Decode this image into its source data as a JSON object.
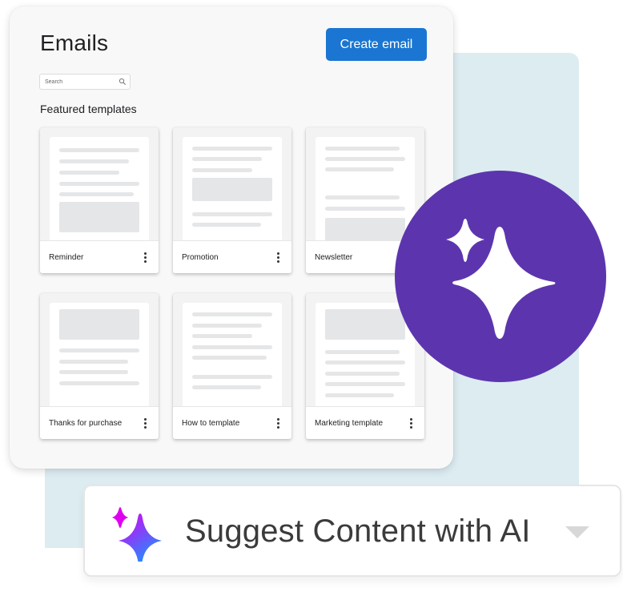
{
  "header": {
    "title": "Emails",
    "create_button": "Create email"
  },
  "search": {
    "placeholder": "Search",
    "value": "",
    "icon": "search-icon"
  },
  "featured": {
    "title": "Featured templates",
    "templates": [
      {
        "name": "Reminder",
        "menu_icon": "more-vert-icon"
      },
      {
        "name": "Promotion",
        "menu_icon": "more-vert-icon"
      },
      {
        "name": "Newsletter",
        "menu_icon": "more-vert-icon"
      },
      {
        "name": "Thanks for purchase",
        "menu_icon": "more-vert-icon"
      },
      {
        "name": "How to template",
        "menu_icon": "more-vert-icon"
      },
      {
        "name": "Marketing template",
        "menu_icon": "more-vert-icon"
      }
    ]
  },
  "ai_badge": {
    "icon": "sparkle-icon"
  },
  "suggest": {
    "label": "Suggest Content with AI",
    "icon": "sparkle-gradient-icon",
    "dropdown_icon": "caret-down-icon"
  },
  "colors": {
    "primary": "#1a76d2",
    "ai_purple": "#5c35ae",
    "background_panel": "#dcecf1",
    "gradient_start": "#f000f0",
    "gradient_end": "#1e90ff"
  }
}
